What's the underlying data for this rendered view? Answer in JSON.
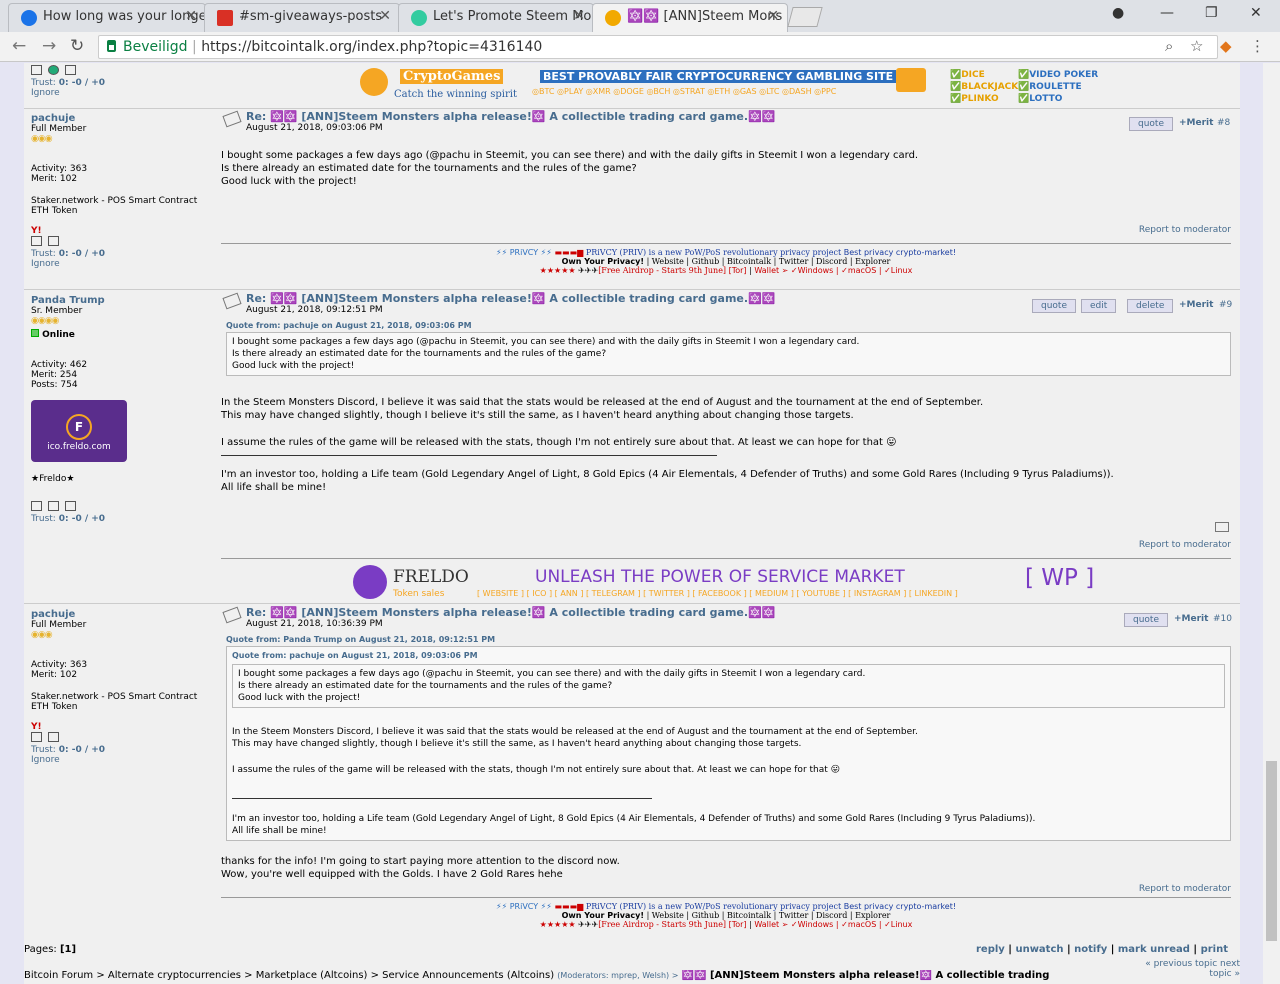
{
  "tabs": [
    {
      "label": "How long was your longe",
      "icon_color": "#1a73e8"
    },
    {
      "label": "#sm-giveaways-posts",
      "icon_color": "#d93025"
    },
    {
      "label": "Let's Promote Steem Mor",
      "icon_color": "#33cca0"
    },
    {
      "label": "🔯🔯 [ANN]Steem Mons",
      "icon_color": "#f2a900"
    }
  ],
  "address": {
    "secure_label": "Beveiligd",
    "url": "https://bitcointalk.org/index.php?topic=4316140"
  },
  "top_banner": {
    "brand": "CryptoGames",
    "tagline": "Catch the winning spirit",
    "headline": "BEST PROVABLY FAIR CRYPTOCURRENCY GAMBLING SITE",
    "coins": "◎BTC ◎PLAY ◎XMR ◎DOGE ◎BCH ◎STRAT ◎ETH ◎GAS ◎LTC ◎DASH ◎PPC",
    "games1": "✅DICE ✅BLACKJACK ✅PLINKO",
    "games2": "✅VIDEO POKER ✅ROULETTE ✅LOTTO"
  },
  "top_user": {
    "trust_label": "Trust:",
    "trust_value": "0: -0 / +0",
    "ignore": "Ignore"
  },
  "posts": [
    {
      "user": "pachuje",
      "rank": "Full Member",
      "stars": "◉◉◉",
      "activity": "Activity: 363",
      "merit": "Merit: 102",
      "sig1": "Staker.network - POS Smart Contract",
      "sig2": "ETH Token",
      "trust_label": "Trust:",
      "trust": "0: -0 / +0",
      "ignore": "Ignore",
      "title": "Re: 🔯🔯 [ANN]Steem Monsters alpha release!🔯 A collectible trading card game.🔯🔯",
      "date": "August 21, 2018, 09:03:06 PM",
      "num": "#8",
      "quote_btn": "quote",
      "merit_btn": "+Merit",
      "lines": [
        "I bought some packages a few days ago (@pachu in Steemit, you can see there) and with the daily gifts in Steemit I won a legendary card.",
        "Is there already an estimated date for the tournaments and the rules of the game?",
        "Good luck with the project!"
      ],
      "report": "Report to moderator"
    },
    {
      "user": "Panda Trump",
      "rank": "Sr. Member",
      "stars": "◉◉◉◉",
      "online": "Online",
      "activity": "Activity: 462",
      "merit": "Merit: 254",
      "posts": "Posts: 754",
      "avatar_text": "ico.freldo.com",
      "personal": "★Freldo★",
      "trust_label": "Trust:",
      "trust": "0: -0 / +0",
      "title": "Re: 🔯🔯 [ANN]Steem Monsters alpha release!🔯 A collectible trading card game.🔯🔯",
      "date": "August 21, 2018, 09:12:51 PM",
      "num": "#9",
      "quote_btn": "quote",
      "edit_btn": "edit",
      "delete_btn": "delete",
      "merit_btn": "+Merit",
      "quote_head": "Quote from: pachuje on August 21, 2018, 09:03:06 PM",
      "quote_lines": [
        "I bought some packages a few days ago (@pachu in Steemit, you can see there) and with the daily gifts in Steemit I won a legendary card.",
        "Is there already an estimated date for the tournaments and the rules of the game?",
        "Good luck with the project!"
      ],
      "lines": [
        "In the Steem Monsters Discord, I believe it was said that the stats would be released at the end of August and the tournament at the end of September.",
        "This may have changed slightly, though I believe it's still the same, as I haven't heard anything about changing those targets."
      ],
      "line3": "I assume the rules of the game will be released with the stats, though I'm not entirely sure about that. At least we can hope for that 😛",
      "lines2": [
        "I'm an investor too, holding a Life team (Gold Legendary Angel of Light, 8 Gold Epics (4 Air Elementals, 4 Defender of Truths) and some Gold Rares (Including 9 Tyrus Paladiums)).",
        "All life shall be mine!"
      ],
      "report": "Report to moderator"
    },
    {
      "user": "pachuje",
      "rank": "Full Member",
      "stars": "◉◉◉",
      "activity": "Activity: 363",
      "merit": "Merit: 102",
      "sig1": "Staker.network - POS Smart Contract",
      "sig2": "ETH Token",
      "trust_label": "Trust:",
      "trust": "0: -0 / +0",
      "ignore": "Ignore",
      "title": "Re: 🔯🔯 [ANN]Steem Monsters alpha release!🔯 A collectible trading card game.🔯🔯",
      "date": "August 21, 2018, 10:36:39 PM",
      "num": "#10",
      "quote_btn": "quote",
      "merit_btn": "+Merit",
      "quote_head": "Quote from: Panda Trump on August 21, 2018, 09:12:51 PM",
      "inner_head": "Quote from: pachuje on August 21, 2018, 09:03:06 PM",
      "lines": [
        "thanks for the info! I'm going to start paying more attention to the discord now.",
        "Wow, you're well equipped with the Golds. I have 2 Gold Rares hehe"
      ],
      "report": "Report to moderator"
    }
  ],
  "privcy": {
    "title": "PRiVCY (PRIV) is a new PoW/PoS revolutionary privacy project",
    "tag": "Best privacy crypto-market!",
    "own": "Own Your Privacy!",
    "links": "| Website | Github | Bitcointalk | Twitter | Discord | Explorer",
    "airdrop": "[Free Airdrop - Starts 9th June]",
    "tor": "[Tor]",
    "wallet": "Wallet ➢ ✓Windows | ✓macOS | ✓Linux"
  },
  "freldo": {
    "name": "FRELDO",
    "sub": "Token sales",
    "slogan": "UNLEASH THE POWER OF SERVICE MARKET",
    "links": "[ WEBSITE ] [ ICO ] [ ANN ] [ TELEGRAM ] [ TWITTER ] [ FACEBOOK ] [ MEDIUM ] [ YOUTUBE ] [ INSTAGRAM ] [ LINKEDIN ]",
    "wp": "[ WP ]"
  },
  "footer": {
    "pages_label": "Pages:",
    "pages": "[1]",
    "actions": [
      "reply",
      "unwatch",
      "notify",
      "mark unread",
      "print"
    ],
    "breadcrumb": "Bitcoin Forum > Alternate cryptocurrencies > Marketplace (Altcoins) > Service Announcements (Altcoins)",
    "moderators": "(Moderators: mprep, Welsh) >",
    "topic": "🔯🔯 [ANN]Steem Monsters alpha release!🔯 A collectible trading",
    "prev": "« previous topic next",
    "topic_word": "topic »"
  }
}
